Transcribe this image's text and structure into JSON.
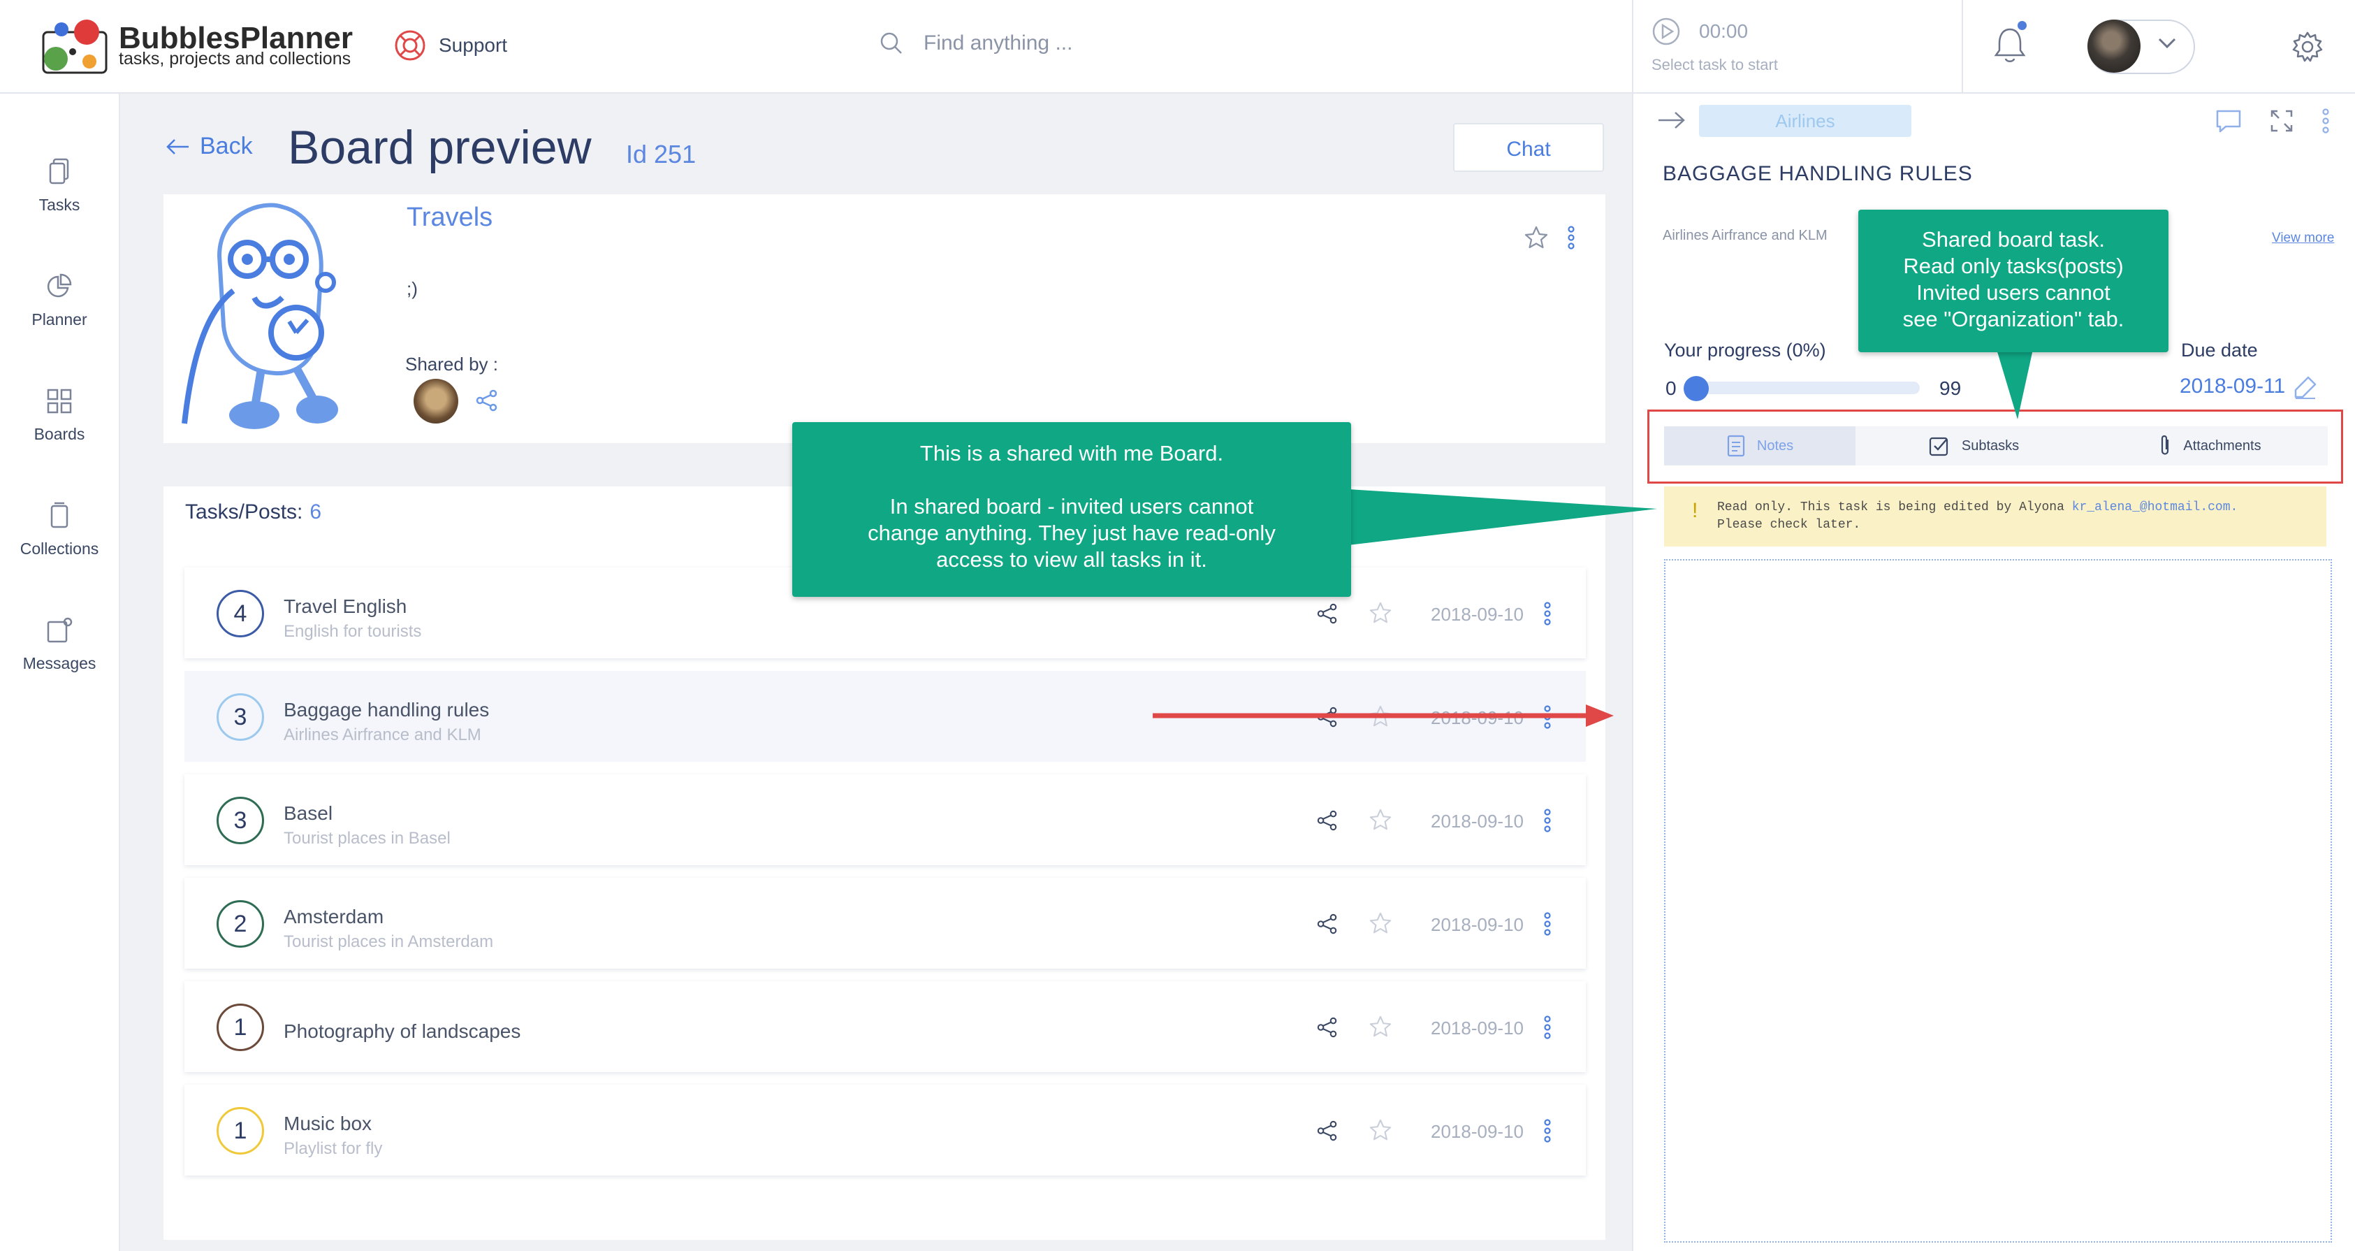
{
  "app": {
    "logo_title": "BubblesPlanner",
    "logo_subtitle": "tasks, projects and collections",
    "support_label": "Support",
    "search_placeholder": "Find anything ...",
    "timer_time": "00:00",
    "timer_hint": "Select task to start"
  },
  "sidebar": {
    "items": [
      {
        "label": "Tasks",
        "icon": "tasks-icon"
      },
      {
        "label": "Planner",
        "icon": "planner-icon"
      },
      {
        "label": "Boards",
        "icon": "boards-icon"
      },
      {
        "label": "Collections",
        "icon": "collections-icon"
      },
      {
        "label": "Messages",
        "icon": "messages-icon"
      }
    ]
  },
  "page": {
    "back_label": "Back",
    "title": "Board preview",
    "id_label": "Id 251",
    "chat_label": "Chat"
  },
  "board": {
    "name": "Travels",
    "description": ";)",
    "shared_by_label": "Shared by :"
  },
  "tasks": {
    "header_label": "Tasks/Posts:",
    "count": "6",
    "items": [
      {
        "num": "4",
        "title": "Travel English",
        "subtitle": "English for tourists",
        "date": "2018-09-10",
        "color": "#3b5ba6"
      },
      {
        "num": "3",
        "title": "Baggage handling rules",
        "subtitle": "Airlines Airfrance and KLM",
        "date": "2018-09-10",
        "color": "#9cc9ee"
      },
      {
        "num": "3",
        "title": "Basel",
        "subtitle": "Tourist places in Basel",
        "date": "2018-09-10",
        "color": "#2f6c54"
      },
      {
        "num": "2",
        "title": "Amsterdam",
        "subtitle": "Tourist places in Amsterdam",
        "date": "2018-09-10",
        "color": "#2f6c54"
      },
      {
        "num": "1",
        "title": "Photography of landscapes",
        "subtitle": "",
        "date": "2018-09-10",
        "color": "#6b4a3a"
      },
      {
        "num": "1",
        "title": "Music box",
        "subtitle": "Playlist for fly",
        "date": "2018-09-10",
        "color": "#f0c93a"
      }
    ]
  },
  "task_detail": {
    "category": "Airlines",
    "title": "BAGGAGE HANDLING RULES",
    "description": "Airlines Airfrance and KLM",
    "view_more": "View more",
    "progress_label": "Your progress  (0%)",
    "progress_min": "0",
    "progress_max": "99",
    "progress_value": 0,
    "due_label": "Due date",
    "due_date": "2018-09-11",
    "tabs": [
      "Notes",
      "Subtasks",
      "Attachments"
    ],
    "readonly_line1": "Read only. This task is being edited by Alyona ",
    "readonly_email": "kr_alena_@hotmail.com.",
    "readonly_line2": " Please check later."
  },
  "callouts": {
    "board": {
      "line1": "This is a shared with me Board.",
      "line2": "In shared board - invited users cannot",
      "line3": "change anything. They just have read-only",
      "line4": "access to view all tasks in it."
    },
    "task": {
      "line1": "Shared board task.",
      "line2": "Read only tasks(posts)",
      "line3": "Invited users cannot",
      "line4": "see \"Organization\" tab."
    }
  },
  "colors": {
    "accent": "#4a7de0",
    "callout": "#0fa784",
    "highlight_red": "#e04848",
    "readonly_bg": "#faf2c6"
  }
}
